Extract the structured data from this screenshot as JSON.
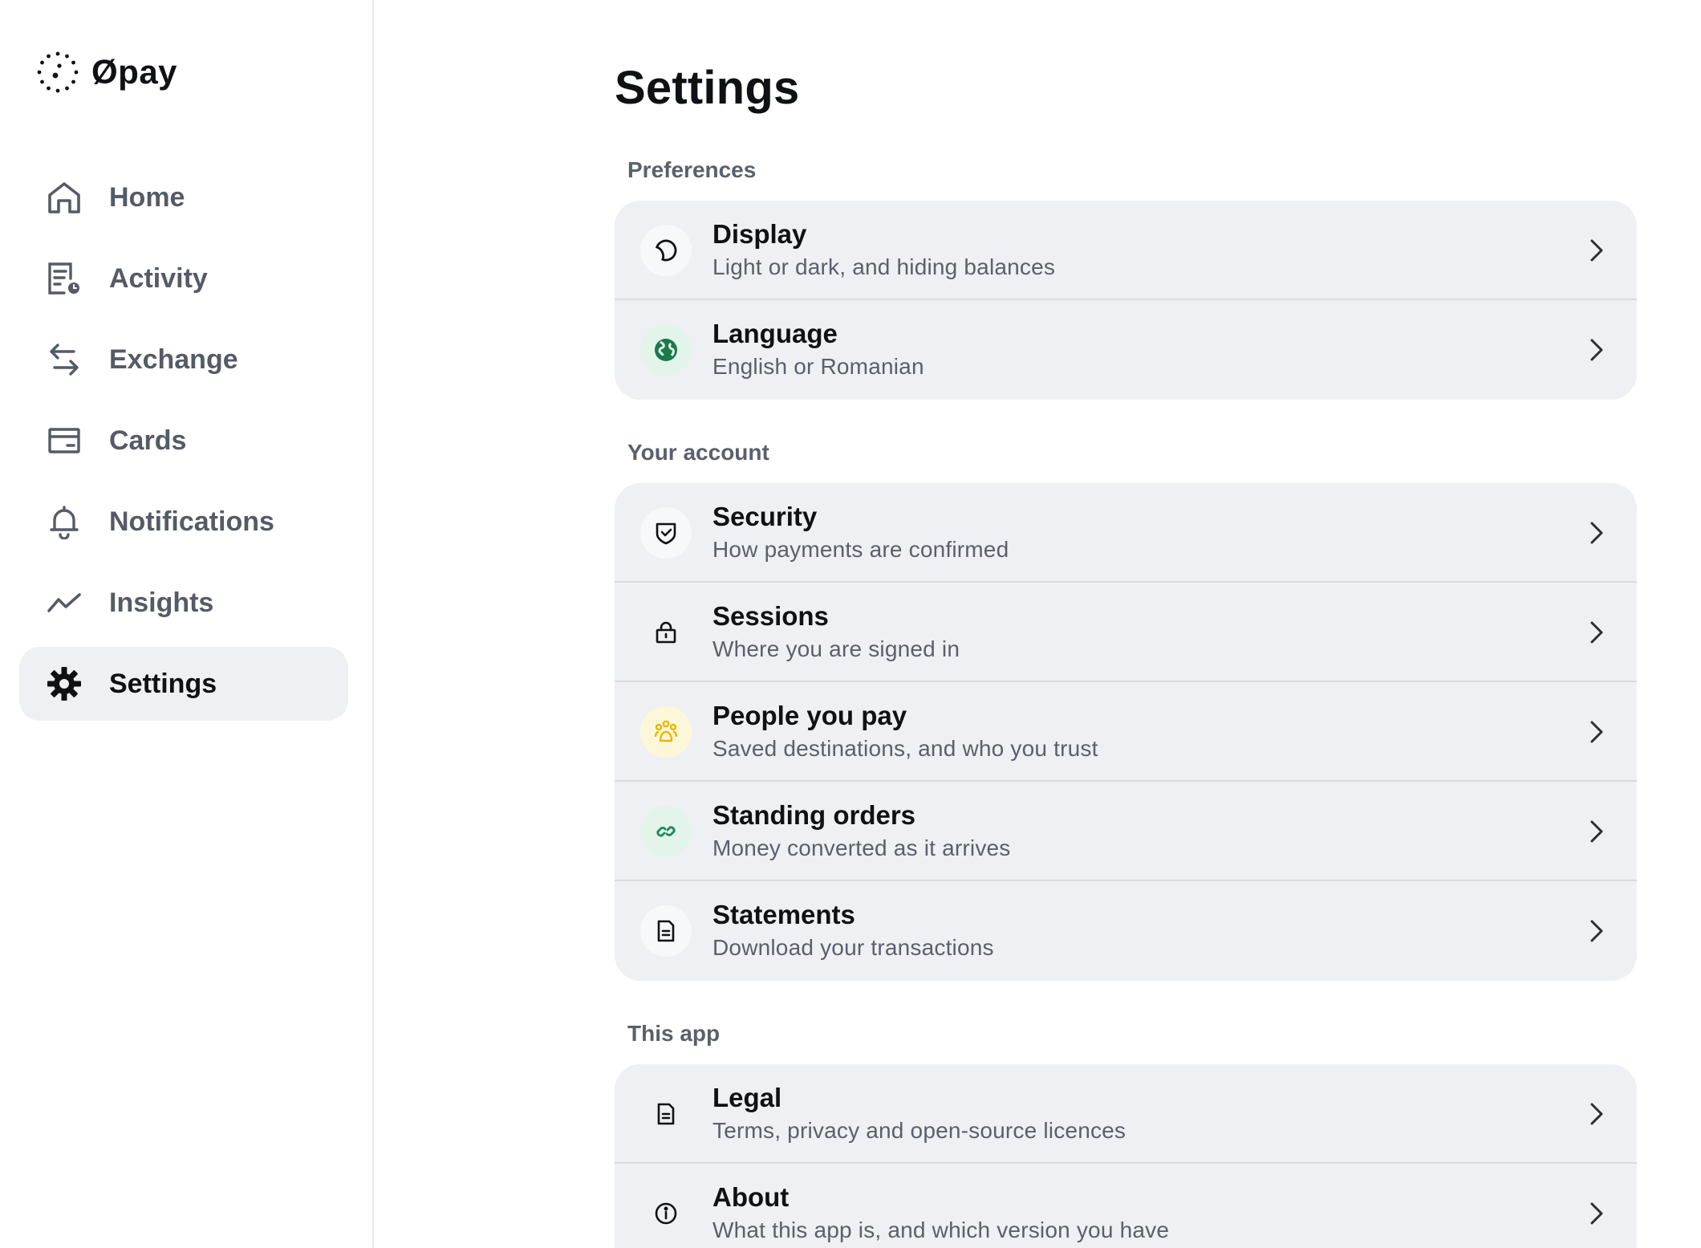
{
  "brand": {
    "name": "Øpay"
  },
  "sidebar": {
    "items": [
      {
        "label": "Home",
        "icon": "home-icon"
      },
      {
        "label": "Activity",
        "icon": "activity-icon"
      },
      {
        "label": "Exchange",
        "icon": "exchange-icon"
      },
      {
        "label": "Cards",
        "icon": "card-icon"
      },
      {
        "label": "Notifications",
        "icon": "bell-icon"
      },
      {
        "label": "Insights",
        "icon": "trend-icon"
      },
      {
        "label": "Settings",
        "icon": "gear-icon",
        "active": true
      }
    ]
  },
  "main": {
    "title": "Settings",
    "sections": [
      {
        "label": "Preferences",
        "rows": [
          {
            "title": "Display",
            "subtitle": "Light or dark, and hiding balances",
            "icon": "moon-icon"
          },
          {
            "title": "Language",
            "subtitle": "English or Romanian",
            "icon": "globe-icon"
          }
        ]
      },
      {
        "label": "Your account",
        "rows": [
          {
            "title": "Security",
            "subtitle": "How payments are confirmed",
            "icon": "shield-check-icon"
          },
          {
            "title": "Sessions",
            "subtitle": "Where you are signed in",
            "icon": "lock-icon"
          },
          {
            "title": "People you pay",
            "subtitle": "Saved destinations, and who you trust",
            "icon": "people-icon"
          },
          {
            "title": "Standing orders",
            "subtitle": "Money converted as it arrives",
            "icon": "link-icon"
          },
          {
            "title": "Statements",
            "subtitle": "Download your transactions",
            "icon": "document-icon"
          }
        ]
      },
      {
        "label": "This app",
        "rows": [
          {
            "title": "Legal",
            "subtitle": "Terms, privacy and open-source licences",
            "icon": "document-icon"
          },
          {
            "title": "About",
            "subtitle": "What this app is, and which version you have",
            "icon": "info-icon"
          }
        ]
      }
    ]
  },
  "colors": {
    "active_bg": "#eff0f3",
    "card_bg": "#eff0f3",
    "globe_green": "#1a7a4c",
    "people_yellow": "#e6b800",
    "link_green": "#1a8a55"
  }
}
